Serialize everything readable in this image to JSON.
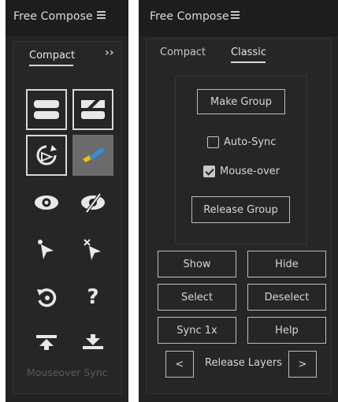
{
  "left_panel": {
    "title": "Free Compose",
    "tab": "Compact",
    "expand_glyph": "››",
    "footer": "Mouseover Sync",
    "icons": [
      "make-group-icon",
      "release-group-icon",
      "sync-once-icon",
      "auto-sync-icon",
      "show-icon",
      "hide-icon",
      "select-icon",
      "deselect-icon",
      "reset-icon",
      "help-icon",
      "release-layers-up-icon",
      "release-layers-down-icon"
    ],
    "help_glyph": "?"
  },
  "right_panel": {
    "title": "Free Compose",
    "tabs": [
      "Compact",
      "Classic"
    ],
    "active_tab": "Classic",
    "make_group": "Make Group",
    "auto_sync": {
      "label": "Auto-Sync",
      "checked": false
    },
    "mouse_over": {
      "label": "Mouse-over",
      "checked": true
    },
    "release_group": "Release Group",
    "buttons": {
      "show": "Show",
      "hide": "Hide",
      "select": "Select",
      "deselect": "Deselect",
      "sync": "Sync 1x",
      "help": "Help"
    },
    "release_layers": {
      "prev": "<",
      "label": "Release Layers",
      "next": ">"
    }
  },
  "colors": {
    "panel_bg": "#232323",
    "titlebar_bg": "#1d1d1d",
    "selected_bg": "#6b6b6b",
    "accent_yellow": "#f2c200",
    "accent_blue": "#2f8fe0"
  }
}
